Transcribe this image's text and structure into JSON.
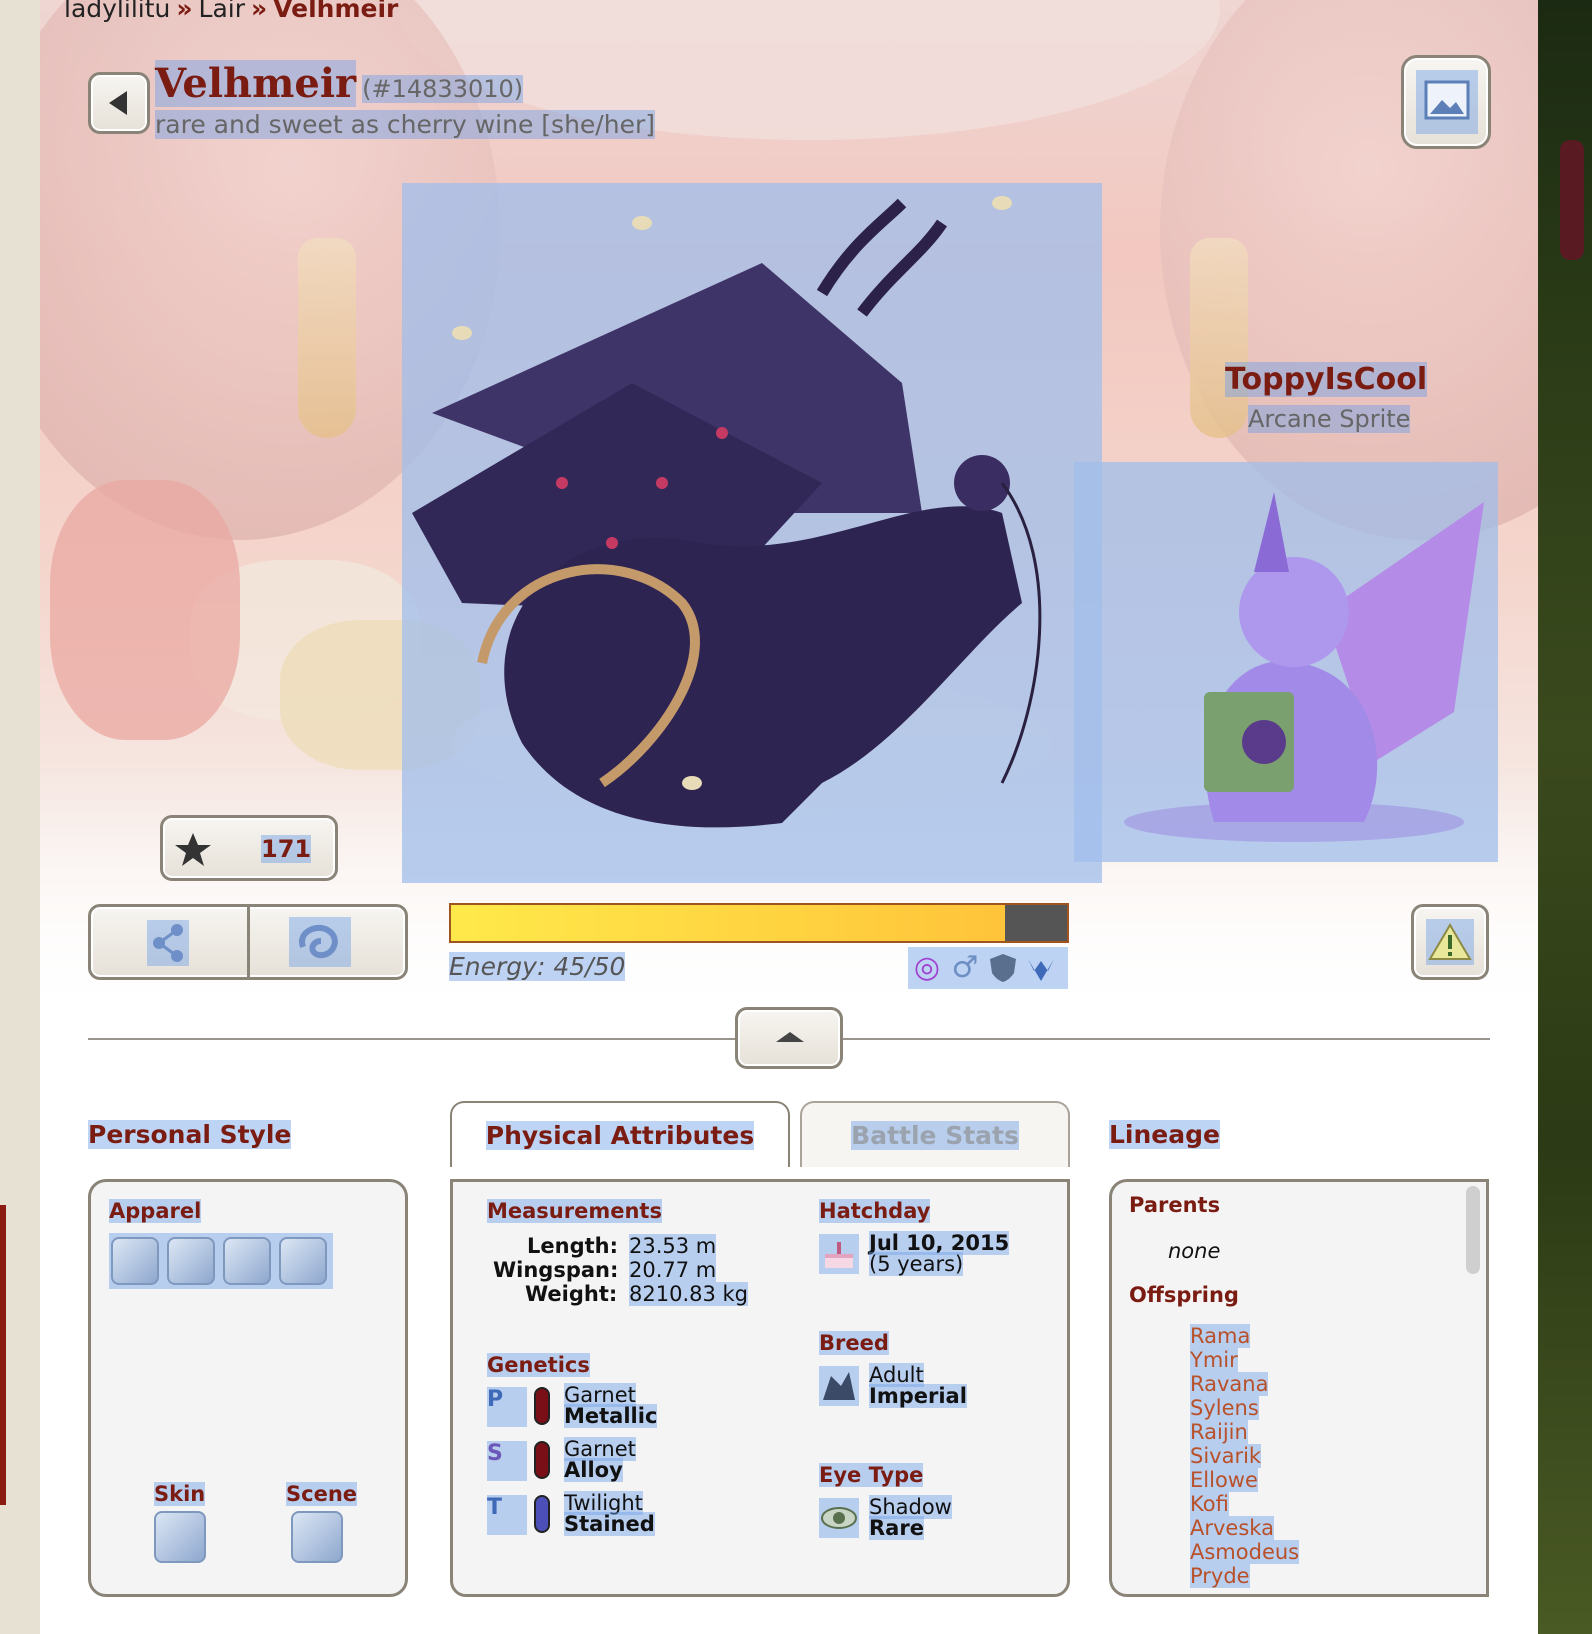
{
  "breadcrumb": {
    "user": "ladylilitu",
    "section": "Lair",
    "current": "Velhmeir",
    "sep": "»"
  },
  "dragon": {
    "name": "Velhmeir",
    "id": "(#14833010)",
    "tagline": "rare and sweet as cherry wine [she/her]"
  },
  "familiar": {
    "name": "ToppyIsCool",
    "type": "Arcane Sprite"
  },
  "favorites": {
    "count": "171"
  },
  "energy": {
    "label": "Energy: 45/50",
    "fraction": 0.9
  },
  "colors": {
    "accent": "#7a1c12",
    "link": "#b8512a",
    "highlight": "#6ea0e6"
  },
  "tabs": {
    "personal_style": "Personal Style",
    "physical": "Physical Attributes",
    "battle": "Battle Stats",
    "lineage": "Lineage"
  },
  "apparel": {
    "label": "Apparel",
    "skin": "Skin",
    "scene": "Scene"
  },
  "measurements": {
    "label": "Measurements",
    "length_label": "Length:",
    "length": "23.53 m",
    "wingspan_label": "Wingspan:",
    "wingspan": "20.77 m",
    "weight_label": "Weight:",
    "weight": "8210.83 kg"
  },
  "hatchday": {
    "label": "Hatchday",
    "date": "Jul 10, 2015",
    "age": "(5 years)"
  },
  "genetics": {
    "label": "Genetics",
    "primary": {
      "color": "Garnet",
      "gene": "Metallic",
      "letter": "P",
      "swatch": "#7a0f18"
    },
    "secondary": {
      "color": "Garnet",
      "gene": "Alloy",
      "letter": "S",
      "swatch": "#7a0f18"
    },
    "tertiary": {
      "color": "Twilight",
      "gene": "Stained",
      "letter": "T",
      "swatch": "#4c4fb8"
    }
  },
  "breed": {
    "label": "Breed",
    "age": "Adult",
    "name": "Imperial"
  },
  "eye": {
    "label": "Eye Type",
    "color": "Shadow",
    "rarity": "Rare"
  },
  "lineage": {
    "parents_label": "Parents",
    "parents": "none",
    "offspring_label": "Offspring",
    "offspring": [
      "Rama",
      "Ymir",
      "Ravana",
      "Sylens",
      "Raijin",
      "Sivarik",
      "Ellowe",
      "Kofi",
      "Arveska",
      "Asmodeus",
      "Pryde"
    ]
  }
}
